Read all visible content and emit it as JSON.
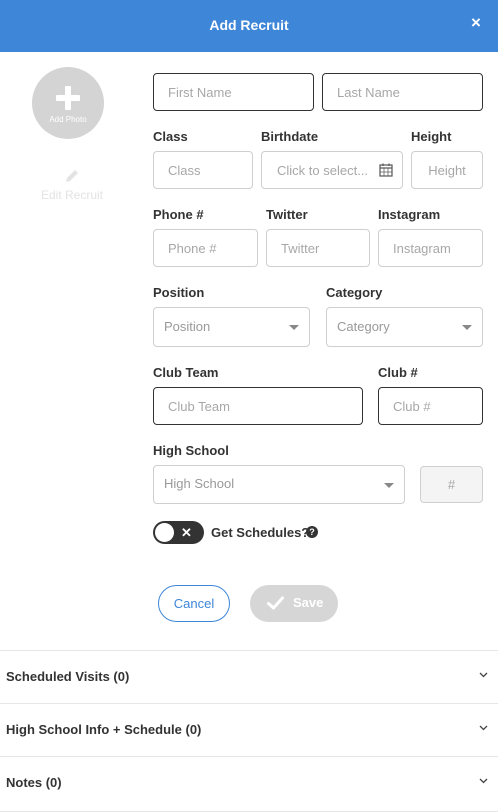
{
  "header": {
    "title": "Add Recruit",
    "close_label": "×"
  },
  "photo": {
    "label": "Add Photo"
  },
  "edit": {
    "label": "Edit Recruit"
  },
  "fields": {
    "first_name": {
      "placeholder": "First Name"
    },
    "last_name": {
      "placeholder": "Last Name"
    },
    "class": {
      "label": "Class",
      "placeholder": "Class"
    },
    "birthdate": {
      "label": "Birthdate",
      "placeholder": "Click to select..."
    },
    "height": {
      "label": "Height",
      "placeholder": "Height"
    },
    "phone": {
      "label": "Phone #",
      "placeholder": "Phone #"
    },
    "twitter": {
      "label": "Twitter",
      "placeholder": "Twitter"
    },
    "instagram": {
      "label": "Instagram",
      "placeholder": "Instagram"
    },
    "position": {
      "label": "Position",
      "selected": "Position"
    },
    "category": {
      "label": "Category",
      "selected": "Category"
    },
    "club_team": {
      "label": "Club Team",
      "placeholder": "Club Team"
    },
    "club_number": {
      "label": "Club #",
      "placeholder": "Club #"
    },
    "high_school": {
      "label": "High School",
      "selected": "High School"
    },
    "high_school_number": {
      "placeholder": "#"
    }
  },
  "toggle": {
    "label": "Get Schedules?",
    "state": "off",
    "help": "?"
  },
  "buttons": {
    "cancel": "Cancel",
    "save": "Save"
  },
  "accordions": [
    {
      "label": "Scheduled Visits (0)"
    },
    {
      "label": "High School Info + Schedule (0)"
    },
    {
      "label": "Notes (0)"
    }
  ],
  "colors": {
    "accent": "#3e86d8",
    "toggle": "#333333",
    "disabled_button": "#d6d6d6"
  }
}
